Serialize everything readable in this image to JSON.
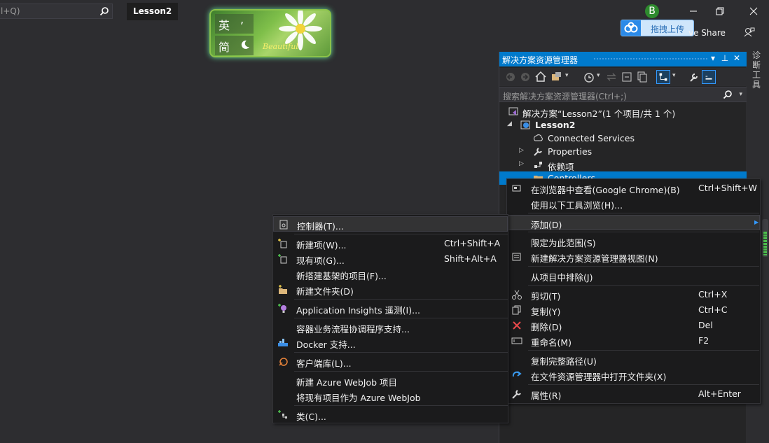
{
  "topbar": {
    "search_text": "l+Q)",
    "project_tab": "Lesson2"
  },
  "ime": {
    "row1_char": "英",
    "row1_sym": ",",
    "row2_char": "简",
    "beautiful": "Beautiful"
  },
  "account": {
    "avatar_letter": "B",
    "upload_label": "拖拽上传",
    "share_label": "ve Share"
  },
  "tool_strip": {
    "label": "诊断工具"
  },
  "solution_explorer": {
    "title": "解决方案资源管理器",
    "search_placeholder": "搜索解决方案资源管理器(Ctrl+;)",
    "tree": [
      {
        "label": "解决方案“Lesson2”(1 个项目/共 1 个)",
        "icon": "solution-icon"
      },
      {
        "label": "Lesson2",
        "icon": "web-project-icon",
        "bold": true
      },
      {
        "label": "Connected Services",
        "icon": "connected-services-icon"
      },
      {
        "label": "Properties",
        "icon": "wrench-icon"
      },
      {
        "label": "依赖项",
        "icon": "dependencies-icon"
      },
      {
        "label": "Controllers",
        "icon": "folder-icon"
      }
    ]
  },
  "context_menu": {
    "items": [
      {
        "label": "在浏览器中查看(Google Chrome)(B)",
        "shortcut": "Ctrl+Shift+W",
        "icon": "browser-icon"
      },
      {
        "label": "使用以下工具浏览(H)...",
        "shortcut": "",
        "icon": ""
      },
      {
        "label": "添加(D)",
        "shortcut": "",
        "icon": ""
      },
      {
        "label": "限定为此范围(S)",
        "shortcut": "",
        "icon": ""
      },
      {
        "label": "新建解决方案资源管理器视图(N)",
        "shortcut": "",
        "icon": "new-view-icon"
      },
      {
        "label": "从项目中排除(J)",
        "shortcut": "",
        "icon": ""
      },
      {
        "label": "剪切(T)",
        "shortcut": "Ctrl+X",
        "icon": "scissors-icon"
      },
      {
        "label": "复制(Y)",
        "shortcut": "Ctrl+C",
        "icon": "copy-icon"
      },
      {
        "label": "删除(D)",
        "shortcut": "Del",
        "icon": "delete-icon"
      },
      {
        "label": "重命名(M)",
        "shortcut": "F2",
        "icon": "rename-icon"
      },
      {
        "label": "复制完整路径(U)",
        "shortcut": "",
        "icon": ""
      },
      {
        "label": "在文件资源管理器中打开文件夹(X)",
        "shortcut": "",
        "icon": "open-folder-icon"
      },
      {
        "label": "属性(R)",
        "shortcut": "Alt+Enter",
        "icon": "wrench-icon"
      }
    ]
  },
  "add_submenu": {
    "items": [
      {
        "label": "控制器(T)...",
        "shortcut": "",
        "icon": "controller-icon"
      },
      {
        "label": "新建项(W)...",
        "shortcut": "Ctrl+Shift+A",
        "icon": "new-item-icon"
      },
      {
        "label": "现有项(G)...",
        "shortcut": "Shift+Alt+A",
        "icon": "existing-item-icon"
      },
      {
        "label": "新搭建基架的项目(F)...",
        "shortcut": "",
        "icon": ""
      },
      {
        "label": "新建文件夹(D)",
        "shortcut": "",
        "icon": "new-folder-icon"
      },
      {
        "label": "Application Insights 遥测(I)...",
        "shortcut": "",
        "icon": "app-insights-icon"
      },
      {
        "label": "容器业务流程协调程序支持...",
        "shortcut": "",
        "icon": ""
      },
      {
        "label": "Docker 支持...",
        "shortcut": "",
        "icon": "docker-icon"
      },
      {
        "label": "客户端库(L)...",
        "shortcut": "",
        "icon": "client-library-icon"
      },
      {
        "label": "新建 Azure WebJob 项目",
        "shortcut": "",
        "icon": ""
      },
      {
        "label": "将现有项目作为 Azure WebJob",
        "shortcut": "",
        "icon": ""
      },
      {
        "label": "类(C)...",
        "shortcut": "",
        "icon": "class-icon"
      }
    ]
  }
}
